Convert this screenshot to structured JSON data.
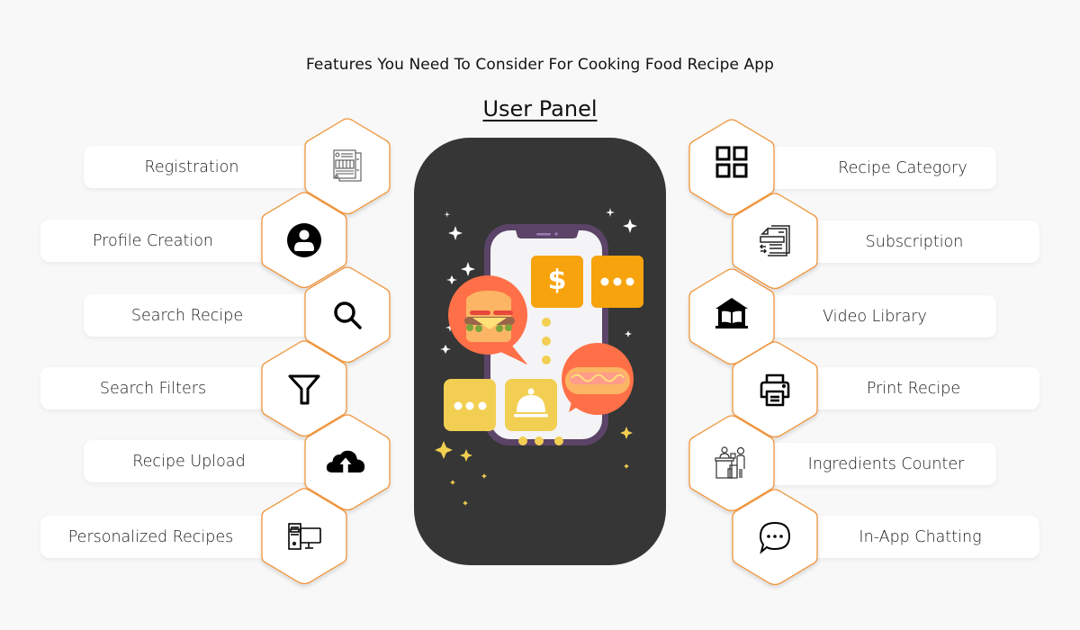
{
  "header": {
    "title": "Features You Need To Consider For Cooking Food Recipe App",
    "subtitle": "User Panel"
  },
  "colors": {
    "background": "#f8f8f8",
    "hex_border": "#f0943a",
    "panel": "#353635",
    "accent_orange": "#f7a30e",
    "accent_yellow": "#f2cf52",
    "bubble_red": "#ff7048",
    "phone_frame": "#5b4467"
  },
  "left_features": [
    {
      "label": "Registration",
      "icon": "registration-form-icon"
    },
    {
      "label": "Profile Creation",
      "icon": "user-profile-icon"
    },
    {
      "label": "Search Recipe",
      "icon": "search-icon"
    },
    {
      "label": "Search Filters",
      "icon": "filter-funnel-icon"
    },
    {
      "label": "Recipe Upload",
      "icon": "cloud-upload-icon"
    },
    {
      "label": "Personalized Recipes",
      "icon": "desktop-computer-icon"
    }
  ],
  "right_features": [
    {
      "label": "Recipe Category",
      "icon": "grid-category-icon"
    },
    {
      "label": "Subscription",
      "icon": "subscription-document-icon"
    },
    {
      "label": "Video Library",
      "icon": "library-building-icon"
    },
    {
      "label": "Print Recipe",
      "icon": "printer-icon"
    },
    {
      "label": "Ingredients Counter",
      "icon": "counter-desk-icon"
    },
    {
      "label": "In-App Chatting",
      "icon": "chat-bubble-icon"
    }
  ],
  "illustration": {
    "dollar_symbol": "$",
    "description": "smartphone with food chat bubbles"
  }
}
